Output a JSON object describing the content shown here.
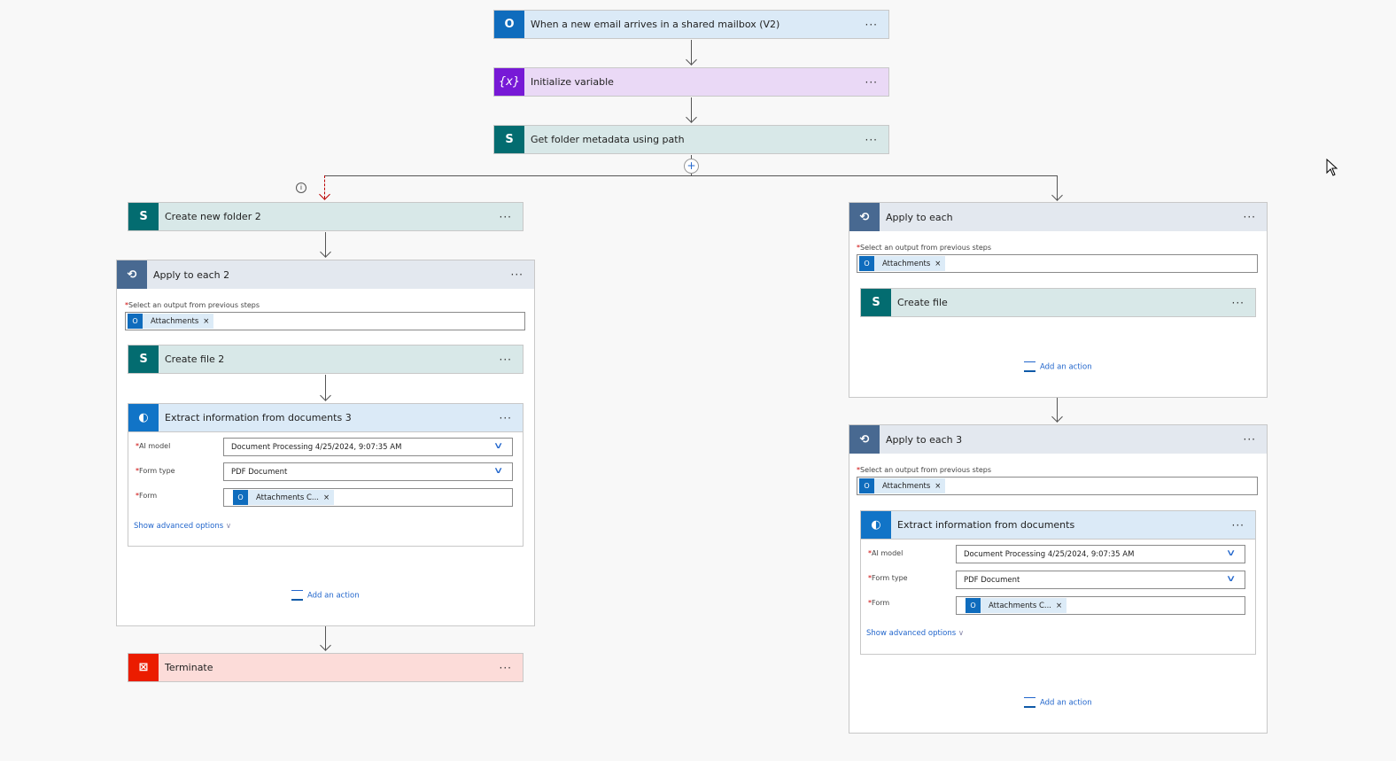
{
  "trigger": {
    "title": "When a new email arrives in a shared mailbox (V2)"
  },
  "init_var": {
    "title": "Initialize variable"
  },
  "get_folder": {
    "title": "Get folder metadata using path"
  },
  "more": "···",
  "left": {
    "create_folder": {
      "title": "Create new folder 2"
    },
    "apply": {
      "title": "Apply to each 2",
      "select_label": "Select an output from previous steps",
      "token": "Attachments"
    },
    "create_file": {
      "title": "Create file 2"
    },
    "extract": {
      "title": "Extract information from documents 3",
      "ai_model_label": "AI model",
      "ai_model": "Document Processing 4/25/2024, 9:07:35 AM",
      "form_type_label": "Form type",
      "form_type": "PDF Document",
      "form_label": "Form",
      "form_token": "Attachments C...",
      "advanced": "Show advanced options"
    },
    "add_action": "Add an action",
    "terminate": {
      "title": "Terminate"
    }
  },
  "right": {
    "apply": {
      "title": "Apply to each",
      "select_label": "Select an output from previous steps",
      "token": "Attachments"
    },
    "create_file": {
      "title": "Create file"
    },
    "add_action": "Add an action",
    "apply3": {
      "title": "Apply to each 3",
      "select_label": "Select an output from previous steps",
      "token": "Attachments"
    },
    "extract": {
      "title": "Extract information from documents",
      "ai_model_label": "AI model",
      "ai_model": "Document Processing 4/25/2024, 9:07:35 AM",
      "form_type_label": "Form type",
      "form_type": "PDF Document",
      "form_label": "Form",
      "form_token": "Attachments C...",
      "advanced": "Show advanced options"
    },
    "add_action3": "Add an action"
  },
  "colors": {
    "outlook": "#0f6cbd",
    "variable": "#7719d6",
    "sharepoint": "#036c70",
    "loop": "#486991",
    "ai": "#1174c7",
    "terminate": "#eb1c00"
  }
}
